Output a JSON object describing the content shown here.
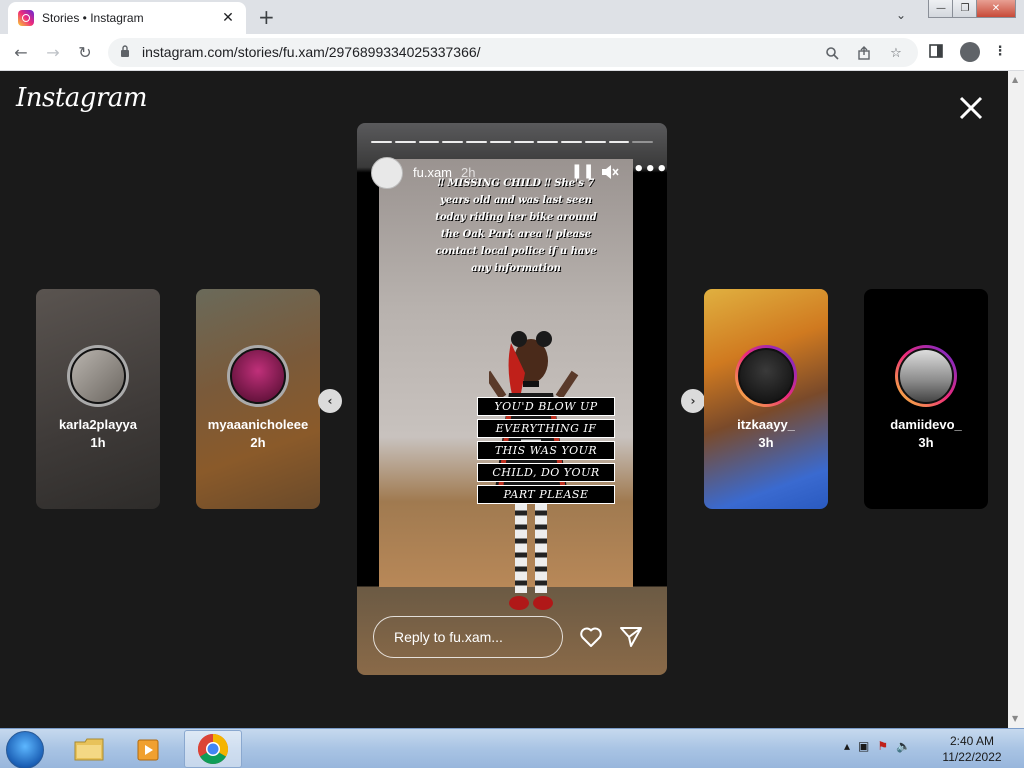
{
  "browser": {
    "tab_title": "Stories • Instagram",
    "tab_close": "✕",
    "new_tab": "+",
    "url": "instagram.com/stories/fu.xam/2976899334025337366/"
  },
  "viewer": {
    "logo": "Instagram",
    "prev_arrow": "‹",
    "next_arrow": "›"
  },
  "side_stories": [
    {
      "username": "karla2playya",
      "time": "1h"
    },
    {
      "username": "myaaanicholeee",
      "time": "2h"
    },
    {
      "username": "itzkaayy_",
      "time": "3h"
    },
    {
      "username": "damiidevo_",
      "time": "3h"
    }
  ],
  "main_story": {
    "username": "fu.xam",
    "time": "2h",
    "caption_top": "‼ MISSING CHILD ‼ She's 7 years old and was last seen today riding her bike around the Oak Park area ‼ please contact local police if u have any information",
    "caption_box": [
      "YOU'D BLOW UP",
      "EVERYTHING IF",
      "THIS WAS YOUR",
      "CHILD, DO YOUR",
      "PART PLEASE"
    ],
    "reply_placeholder": "Reply to fu.xam...",
    "progress_segments": 12,
    "active_segment": 11
  },
  "taskbar": {
    "time": "2:40 AM",
    "date": "11/22/2022"
  },
  "colors": {
    "background": "#1a1a1a",
    "ig_gradient_start": "#f9ce34",
    "ig_gradient_end": "#ee2a7b"
  }
}
